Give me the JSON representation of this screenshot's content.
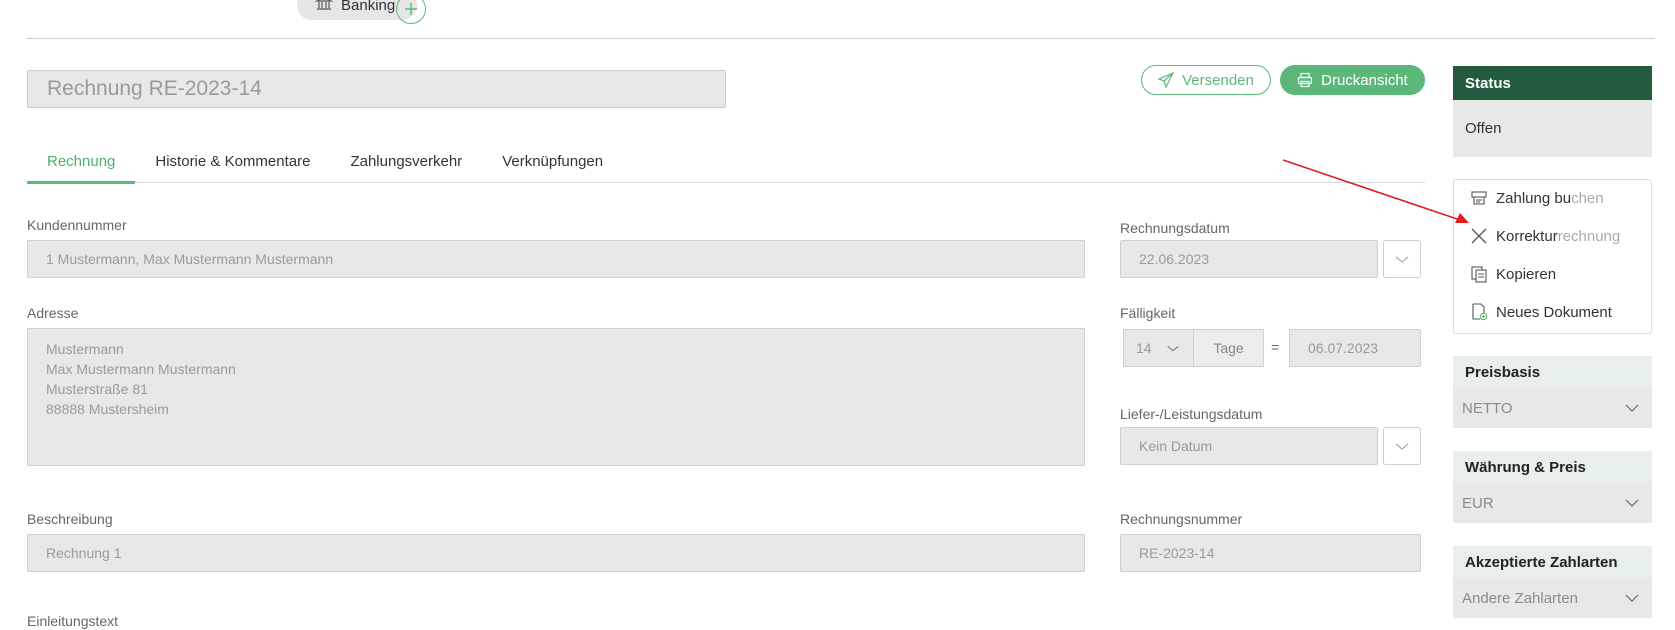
{
  "top_chip": {
    "label": "Banking",
    "icon": "bank-icon"
  },
  "title_input": {
    "value": "Rechnung RE-2023-14"
  },
  "actions": {
    "send_label": "Versenden",
    "print_label": "Druckansicht"
  },
  "tabs": [
    {
      "label": "Rechnung",
      "active": true
    },
    {
      "label": "Historie & Kommentare"
    },
    {
      "label": "Zahlungsverkehr"
    },
    {
      "label": "Verknüpfungen"
    }
  ],
  "form": {
    "kundennummer": {
      "label": "Kundennummer",
      "value": "1 Mustermann, Max Mustermann Mustermann"
    },
    "adresse": {
      "label": "Adresse",
      "lines": [
        "Mustermann",
        "Max Mustermann Mustermann",
        "Musterstraße 81",
        "88888 Mustersheim"
      ]
    },
    "beschreibung": {
      "label": "Beschreibung",
      "value": "Rechnung 1"
    },
    "einleitungstext": {
      "label": "Einleitungstext"
    },
    "rechnungsdatum": {
      "label": "Rechnungsdatum",
      "value": "22.06.2023"
    },
    "faelligkeit": {
      "label": "Fälligkeit",
      "days": "14",
      "unit": "Tage",
      "equals": "=",
      "date": "06.07.2023"
    },
    "lieferdatum": {
      "label": "Liefer-/Leistungsdatum",
      "placeholder": "Kein Datum"
    },
    "rechnungsnummer": {
      "label": "Rechnungsnummer",
      "value": "RE-2023-14"
    }
  },
  "sidebar": {
    "status": {
      "title": "Status",
      "value": "Offen"
    },
    "menu": [
      {
        "label_main": "Zahlung bu",
        "label_dim": "chen",
        "icon": "payment-icon"
      },
      {
        "label_main": "Korrektur",
        "label_dim": "rechnung",
        "icon": "close-icon"
      },
      {
        "label_main": "Kopieren",
        "label_dim": "",
        "icon": "copy-icon"
      },
      {
        "label_main": "Neues Dokument",
        "label_dim": "",
        "icon": "new-document-icon"
      }
    ],
    "preisbasis": {
      "title": "Preisbasis",
      "value": "NETTO"
    },
    "waehrung": {
      "title": "Währung & Preis",
      "value": "EUR"
    },
    "zahlarten": {
      "title": "Akzeptierte Zahlarten",
      "value": "Andere Zahlarten"
    }
  },
  "colors": {
    "accent": "#5cb87a",
    "status_header": "#245b3e",
    "annotation_arrow": "#e02020"
  }
}
